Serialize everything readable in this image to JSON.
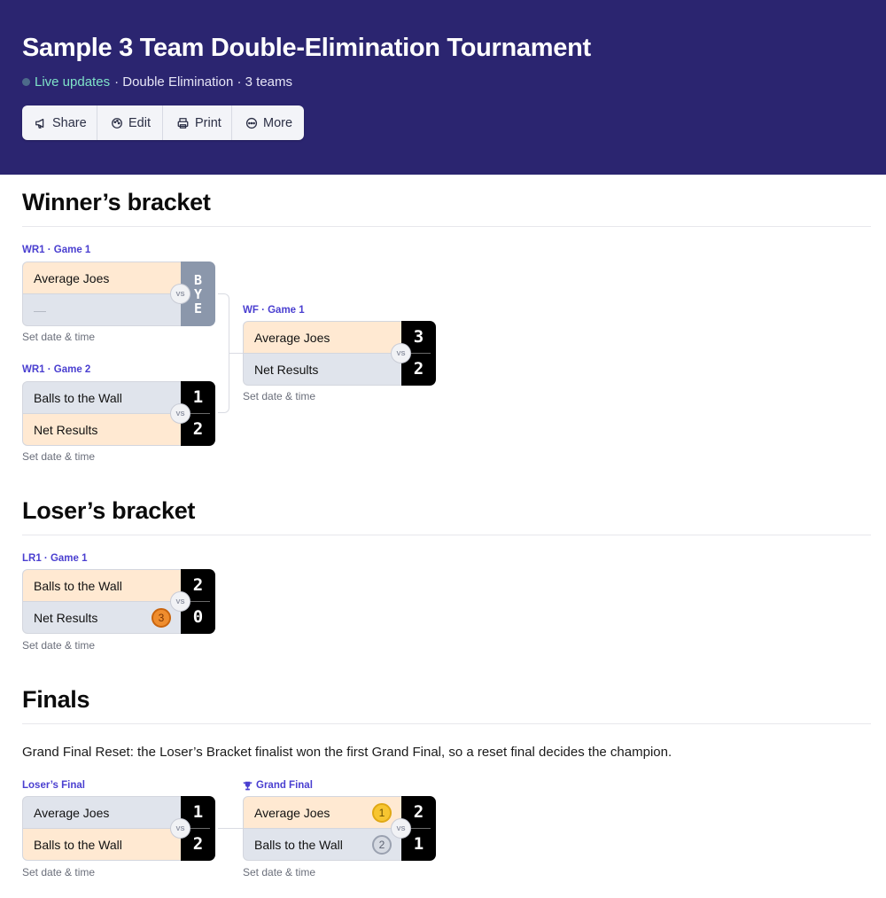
{
  "header": {
    "title": "Sample 3 Team Double-Elimination Tournament",
    "live_label": "Live updates",
    "meta": "· Double Elimination · 3 teams",
    "toolbar": {
      "share": "Share",
      "edit": "Edit",
      "print": "Print",
      "more": "More"
    }
  },
  "sections": {
    "winners": "Winner’s bracket",
    "losers": "Loser’s bracket",
    "finals": "Finals"
  },
  "common": {
    "vs": "VS",
    "set_date": "Set date & time",
    "bye": [
      "B",
      "Y",
      "E"
    ]
  },
  "matches": {
    "wr1g1": {
      "label": "WR1 · Game 1",
      "team1": "Average Joes",
      "team2": "—"
    },
    "wr1g2": {
      "label": "WR1 · Game 2",
      "team1": "Balls to the Wall",
      "score1": "1",
      "team2": "Net Results",
      "score2": "2"
    },
    "wf": {
      "label": "WF · Game 1",
      "team1": "Average Joes",
      "score1": "3",
      "team2": "Net Results",
      "score2": "2"
    },
    "lr1g1": {
      "label": "LR1 · Game 1",
      "team1": "Balls to the Wall",
      "score1": "2",
      "team2": "Net Results",
      "score2": "0",
      "seed2": "3"
    },
    "lf": {
      "label": "Loser’s Final",
      "team1": "Average Joes",
      "score1": "1",
      "team2": "Balls to the Wall",
      "score2": "2"
    },
    "gf": {
      "label": "Grand Final",
      "team1": "Average Joes",
      "score1": "2",
      "seed1": "1",
      "team2": "Balls to the Wall",
      "score2": "1",
      "seed2": "2"
    }
  },
  "finals_note": "Grand Final Reset: the Loser’s Bracket finalist won the first Grand Final, so a reset final decides the champion.",
  "colors": {
    "header_bg": "#2b2570",
    "accent": "#4a3fd0",
    "winner_row": "#ffe9d2",
    "loser_row": "#e0e4ec",
    "score_bg": "#000000",
    "bye_bg": "#8b97ab",
    "live": "#7fe3c8",
    "gold": "#f7c531",
    "silver": "#d6dae2",
    "bronze": "#ef8d2e"
  },
  "icons": {
    "share": "megaphone-icon",
    "edit": "palette-icon",
    "print": "printer-icon",
    "more": "more-circle-icon",
    "grand_final": "trophy-icon"
  }
}
